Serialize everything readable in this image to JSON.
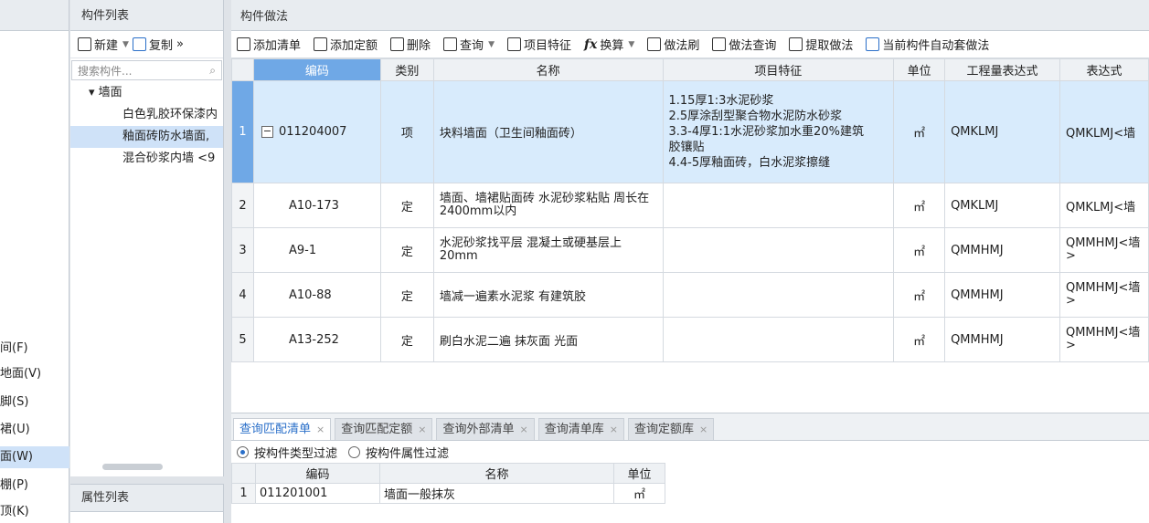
{
  "nav": {
    "items": [
      "间(F)",
      "地面(V)",
      "脚(S)",
      "裙(U)",
      "面(W)",
      "棚(P)",
      "顶(K)"
    ],
    "active_index": 4
  },
  "component_list": {
    "title": "构件列表",
    "toolbar": {
      "new_label": "新建",
      "copy_label": "复制",
      "more": "»"
    },
    "search_placeholder": "搜索构件...",
    "tree": {
      "root": "墙面",
      "children": [
        "白色乳胶环保漆内",
        "釉面砖防水墙面,",
        "混合砂浆内墙 <9"
      ],
      "selected_index": 1
    }
  },
  "property_panel": {
    "title": "属性列表"
  },
  "main": {
    "title": "构件做法",
    "toolbar": {
      "add_list": "添加清单",
      "add_quota": "添加定额",
      "delete": "删除",
      "query": "查询",
      "item_feature": "项目特征",
      "fx_symbol": "fx",
      "convert": "换算",
      "method_brush": "做法刷",
      "method_query": "做法查询",
      "extract_method": "提取做法",
      "auto_apply": "当前构件自动套做法"
    },
    "table": {
      "headers": [
        "编码",
        "类别",
        "名称",
        "项目特征",
        "单位",
        "工程量表达式",
        "表达式"
      ],
      "rows": [
        {
          "num": "1",
          "code": "011204007",
          "type": "项",
          "name": "块料墙面（卫生间釉面砖）",
          "feature": [
            "1.15厚1:3水泥砂浆",
            "2.5厚涂刮型聚合物水泥防水砂浆",
            "3.3-4厚1:1水泥砂浆加水重20%建筑",
            "胶镶贴",
            "4.4-5厚釉面砖，白水泥浆擦缝"
          ],
          "unit": "㎡",
          "expr": "QMKLMJ",
          "expr2": "QMKLMJ<墙"
        },
        {
          "num": "2",
          "code": "A10-173",
          "type": "定",
          "name": "墙面、墙裙贴面砖 水泥砂浆粘贴 周长在2400mm以内",
          "feature": [],
          "unit": "㎡",
          "expr": "QMKLMJ",
          "expr2": "QMKLMJ<墙"
        },
        {
          "num": "3",
          "code": "A9-1",
          "type": "定",
          "name": "水泥砂浆找平层 混凝土或硬基层上 20mm",
          "feature": [],
          "unit": "㎡",
          "expr": "QMMHMJ",
          "expr2": "QMMHMJ<墙",
          "expr2b": ">"
        },
        {
          "num": "4",
          "code": "A10-88",
          "type": "定",
          "name": "墙减一遍素水泥浆 有建筑胶",
          "feature": [],
          "unit": "㎡",
          "expr": "QMMHMJ",
          "expr2": "QMMHMJ<墙",
          "expr2b": ">"
        },
        {
          "num": "5",
          "code": "A13-252",
          "type": "定",
          "name": "刷白水泥二遍 抹灰面 光面",
          "feature": [],
          "unit": "㎡",
          "expr": "QMMHMJ",
          "expr2": "QMMHMJ<墙",
          "expr2b": ">"
        }
      ]
    }
  },
  "bottom": {
    "tabs": [
      "查询匹配清单",
      "查询匹配定额",
      "查询外部清单",
      "查询清单库",
      "查询定额库"
    ],
    "active_tab": 0,
    "filters": [
      "按构件类型过滤",
      "按构件属性过滤"
    ],
    "table": {
      "headers": [
        "编码",
        "名称",
        "单位"
      ],
      "rows": [
        {
          "num": "1",
          "code": "011201001",
          "name": "墙面一般抹灰",
          "unit": "㎡"
        }
      ]
    }
  }
}
